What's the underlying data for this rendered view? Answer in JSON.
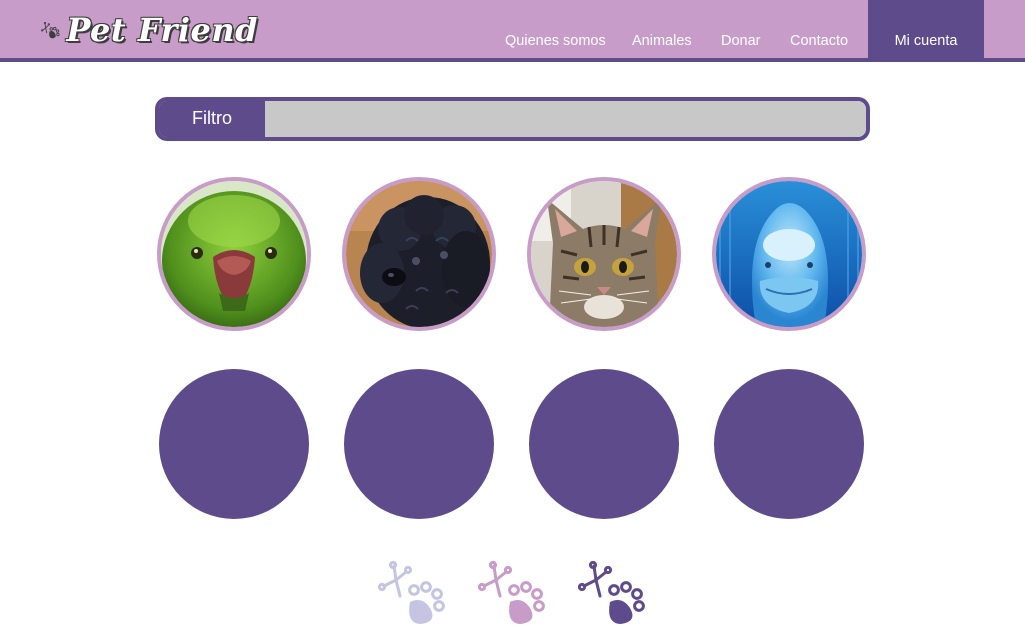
{
  "header": {
    "brand": "Pet Friend",
    "nav": [
      {
        "label": "Quienes somos"
      },
      {
        "label": "Animales"
      },
      {
        "label": "Donar"
      },
      {
        "label": "Contacto"
      }
    ],
    "account_label": "Mi cuenta"
  },
  "filter": {
    "label": "Filtro",
    "value": ""
  },
  "animals": [
    {
      "kind": "parrot"
    },
    {
      "kind": "dog"
    },
    {
      "kind": "cat"
    },
    {
      "kind": "dolphin"
    }
  ],
  "colors": {
    "header": "#c89cc8",
    "accent": "#5e4b8b",
    "filter_field": "#c8c8c8",
    "paw_light": "#c5c5e3",
    "paw_mid": "#c89cc8",
    "paw_dark": "#5e4b8b"
  },
  "pagination": {
    "current": 3,
    "total": 3,
    "icon": "paw-icon"
  }
}
